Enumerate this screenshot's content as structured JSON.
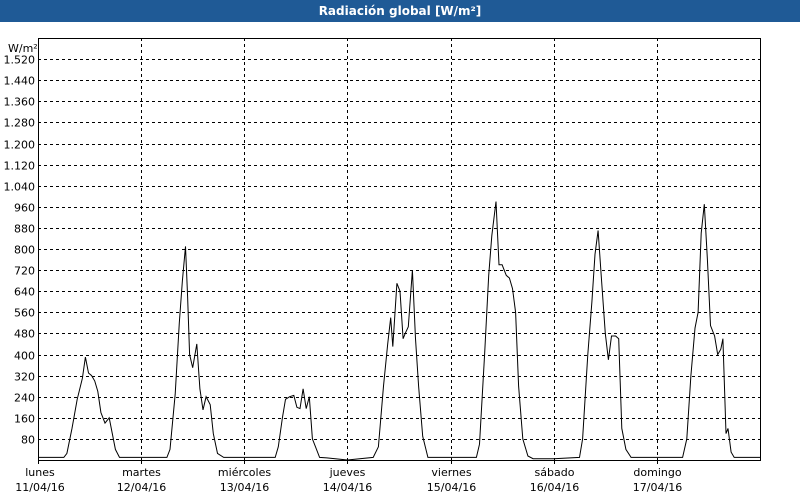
{
  "chart_data": {
    "type": "line",
    "title": "Radiación global [W/m²]",
    "ylabel": "W/m²",
    "ylim": [
      0,
      1600
    ],
    "yticks": [
      80,
      160,
      240,
      320,
      400,
      480,
      560,
      640,
      720,
      800,
      880,
      960,
      1040,
      1120,
      1200,
      1280,
      1360,
      1440,
      1520
    ],
    "ytick_labels": [
      "80",
      "160",
      "240",
      "320",
      "400",
      "480",
      "560",
      "640",
      "720",
      "800",
      "880",
      "960",
      "1.040",
      "1.120",
      "1.200",
      "1.280",
      "1.360",
      "1.440",
      "1.520"
    ],
    "xlim": [
      0,
      7
    ],
    "x_unit": "days from 11/04/16 00:00",
    "xticks": [
      {
        "day": "lunes",
        "date": "11/04/16"
      },
      {
        "day": "martes",
        "date": "12/04/16"
      },
      {
        "day": "miércoles",
        "date": "13/04/16"
      },
      {
        "day": "jueves",
        "date": "14/04/16"
      },
      {
        "day": "viernes",
        "date": "15/04/16"
      },
      {
        "day": "sábado",
        "date": "16/04/16"
      },
      {
        "day": "domingo",
        "date": "17/04/16"
      }
    ],
    "grid": true,
    "colors": {
      "line": "#000000",
      "grid": "#000000",
      "title_bar": "#1f5a96",
      "title_text": "#ffffff"
    },
    "series": [
      {
        "points": [
          [
            0.0,
            10
          ],
          [
            0.25,
            10
          ],
          [
            0.28,
            25
          ],
          [
            0.33,
            120
          ],
          [
            0.38,
            230
          ],
          [
            0.43,
            310
          ],
          [
            0.46,
            390
          ],
          [
            0.49,
            330
          ],
          [
            0.52,
            320
          ],
          [
            0.55,
            300
          ],
          [
            0.58,
            260
          ],
          [
            0.61,
            180
          ],
          [
            0.65,
            140
          ],
          [
            0.69,
            160
          ],
          [
            0.72,
            100
          ],
          [
            0.75,
            40
          ],
          [
            0.79,
            10
          ],
          [
            1.0,
            10
          ],
          [
            1.25,
            10
          ],
          [
            1.28,
            40
          ],
          [
            1.33,
            250
          ],
          [
            1.37,
            520
          ],
          [
            1.4,
            680
          ],
          [
            1.43,
            810
          ],
          [
            1.45,
            620
          ],
          [
            1.47,
            400
          ],
          [
            1.5,
            350
          ],
          [
            1.54,
            440
          ],
          [
            1.57,
            270
          ],
          [
            1.6,
            190
          ],
          [
            1.63,
            240
          ],
          [
            1.67,
            210
          ],
          [
            1.7,
            100
          ],
          [
            1.74,
            25
          ],
          [
            1.8,
            10
          ],
          [
            2.0,
            10
          ],
          [
            2.3,
            10
          ],
          [
            2.33,
            50
          ],
          [
            2.37,
            160
          ],
          [
            2.4,
            230
          ],
          [
            2.44,
            240
          ],
          [
            2.48,
            245
          ],
          [
            2.51,
            200
          ],
          [
            2.54,
            195
          ],
          [
            2.57,
            270
          ],
          [
            2.6,
            195
          ],
          [
            2.63,
            240
          ],
          [
            2.66,
            80
          ],
          [
            2.69,
            50
          ],
          [
            2.73,
            10
          ],
          [
            2.8,
            8
          ],
          [
            3.0,
            0
          ],
          [
            3.25,
            10
          ],
          [
            3.3,
            50
          ],
          [
            3.35,
            280
          ],
          [
            3.39,
            440
          ],
          [
            3.42,
            540
          ],
          [
            3.44,
            430
          ],
          [
            3.48,
            670
          ],
          [
            3.51,
            640
          ],
          [
            3.54,
            460
          ],
          [
            3.56,
            480
          ],
          [
            3.59,
            505
          ],
          [
            3.61,
            610
          ],
          [
            3.63,
            720
          ],
          [
            3.66,
            460
          ],
          [
            3.69,
            280
          ],
          [
            3.73,
            90
          ],
          [
            3.78,
            10
          ],
          [
            4.0,
            10
          ],
          [
            4.25,
            10
          ],
          [
            4.28,
            60
          ],
          [
            4.33,
            400
          ],
          [
            4.37,
            700
          ],
          [
            4.4,
            850
          ],
          [
            4.44,
            980
          ],
          [
            4.47,
            740
          ],
          [
            4.5,
            740
          ],
          [
            4.54,
            700
          ],
          [
            4.57,
            690
          ],
          [
            4.6,
            650
          ],
          [
            4.63,
            560
          ],
          [
            4.66,
            280
          ],
          [
            4.7,
            80
          ],
          [
            4.75,
            15
          ],
          [
            4.8,
            5
          ],
          [
            5.0,
            5
          ],
          [
            5.25,
            10
          ],
          [
            5.28,
            80
          ],
          [
            5.33,
            400
          ],
          [
            5.37,
            600
          ],
          [
            5.4,
            780
          ],
          [
            5.43,
            870
          ],
          [
            5.46,
            700
          ],
          [
            5.5,
            480
          ],
          [
            5.53,
            380
          ],
          [
            5.56,
            470
          ],
          [
            5.6,
            470
          ],
          [
            5.63,
            460
          ],
          [
            5.66,
            120
          ],
          [
            5.7,
            40
          ],
          [
            5.75,
            10
          ],
          [
            6.0,
            10
          ],
          [
            6.25,
            10
          ],
          [
            6.29,
            80
          ],
          [
            6.33,
            320
          ],
          [
            6.37,
            500
          ],
          [
            6.4,
            560
          ],
          [
            6.43,
            860
          ],
          [
            6.46,
            970
          ],
          [
            6.49,
            760
          ],
          [
            6.52,
            510
          ],
          [
            6.56,
            470
          ],
          [
            6.59,
            400
          ],
          [
            6.62,
            420
          ],
          [
            6.64,
            460
          ],
          [
            6.67,
            100
          ],
          [
            6.69,
            120
          ],
          [
            6.72,
            30
          ],
          [
            6.75,
            10
          ],
          [
            6.9,
            10
          ],
          [
            7.0,
            10
          ]
        ]
      }
    ]
  }
}
